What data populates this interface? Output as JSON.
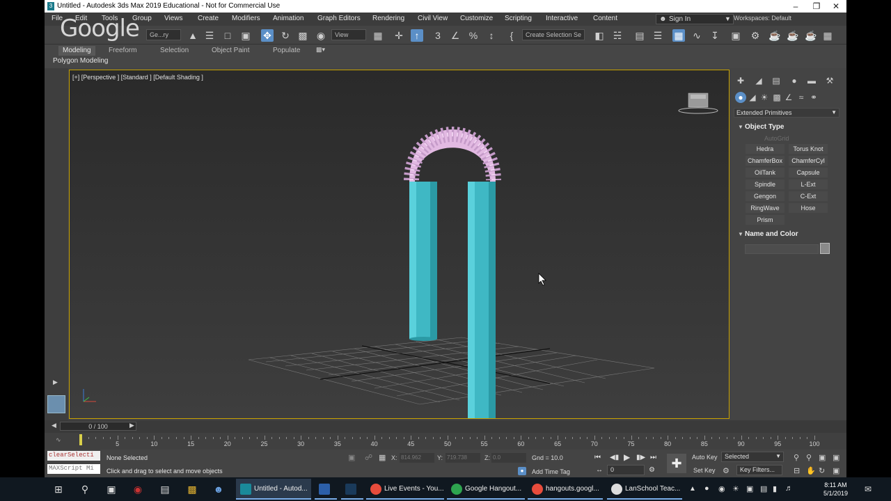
{
  "window": {
    "title": "Untitled - Autodesk 3ds Max 2019 Educational - Not for Commercial Use",
    "app_icon_letter": "3"
  },
  "overlay": {
    "google_logo": "Google"
  },
  "menubar": {
    "items": [
      "File",
      "Edit",
      "Tools",
      "Group",
      "Views",
      "Create",
      "Modifiers",
      "Animation",
      "Graph Editors",
      "Rendering",
      "Civil View",
      "Customize",
      "Scripting",
      "Interactive",
      "Content"
    ],
    "sign_in": "Sign In",
    "workspaces": "Workspaces: Default"
  },
  "toolbar": {
    "selection_filter": "Ge...ry",
    "reference_coord": "View",
    "named_selection": "Create Selection Se"
  },
  "ribbon": {
    "tabs": [
      "Modeling",
      "Freeform",
      "Selection",
      "Object Paint",
      "Populate"
    ],
    "active_tab": "Modeling",
    "panel_label": "Polygon Modeling"
  },
  "viewport": {
    "label": "[+] [Perspective ] [Standard ] [Default Shading ]",
    "cylinder_color": "#40c4cf",
    "hose_color": "#e6bde6",
    "border_color": "#c9a300"
  },
  "command_panel": {
    "category": "Extended Primitives",
    "object_type_title": "Object Type",
    "autogrid": "AutoGrid",
    "buttons": [
      "Hedra",
      "Torus Knot",
      "ChamferBox",
      "ChamferCyl",
      "OilTank",
      "Capsule",
      "Spindle",
      "L-Ext",
      "Gengon",
      "C-Ext",
      "RingWave",
      "Hose",
      "Prism"
    ],
    "name_color_title": "Name and Color"
  },
  "timeline": {
    "frame_display": "0 / 100",
    "ticks": [
      5,
      10,
      15,
      20,
      25,
      30,
      35,
      40,
      45,
      50,
      55,
      60,
      65,
      70,
      75,
      80,
      85,
      90,
      95,
      100
    ]
  },
  "statusbar": {
    "maxscript_line1": "clearSelecti",
    "maxscript_line2": "MAXScript Mi",
    "selection_status": "None Selected",
    "prompt": "Click and drag to select and move objects",
    "x_label": "X:",
    "x_value": "814.962",
    "y_label": "Y:",
    "y_value": "719.738",
    "z_label": "Z:",
    "z_value": "0.0",
    "grid": "Gnd = 10.0",
    "add_time_tag": "Add Time Tag",
    "auto_key": "Auto Key",
    "set_key": "Set Key",
    "selected_dropdown": "Selected",
    "key_filters": "Key Filters...",
    "frame_field": "0"
  },
  "taskbar": {
    "apps": [
      {
        "label": "Untitled - Autod...",
        "color": "#1a8a9a",
        "active": true
      },
      {
        "label": "",
        "color": "#c0392b"
      },
      {
        "label": "",
        "color": "#2c5fa8"
      },
      {
        "label": "Live Events - You...",
        "color": "#e74c3c"
      },
      {
        "label": "Google Hangout...",
        "color": "#2ea44f"
      },
      {
        "label": "hangouts.googl...",
        "color": "#e74c3c"
      },
      {
        "label": "LanSchool Teac...",
        "color": "#dddddd"
      }
    ],
    "time": "8:11 AM",
    "date": "5/1/2019"
  }
}
